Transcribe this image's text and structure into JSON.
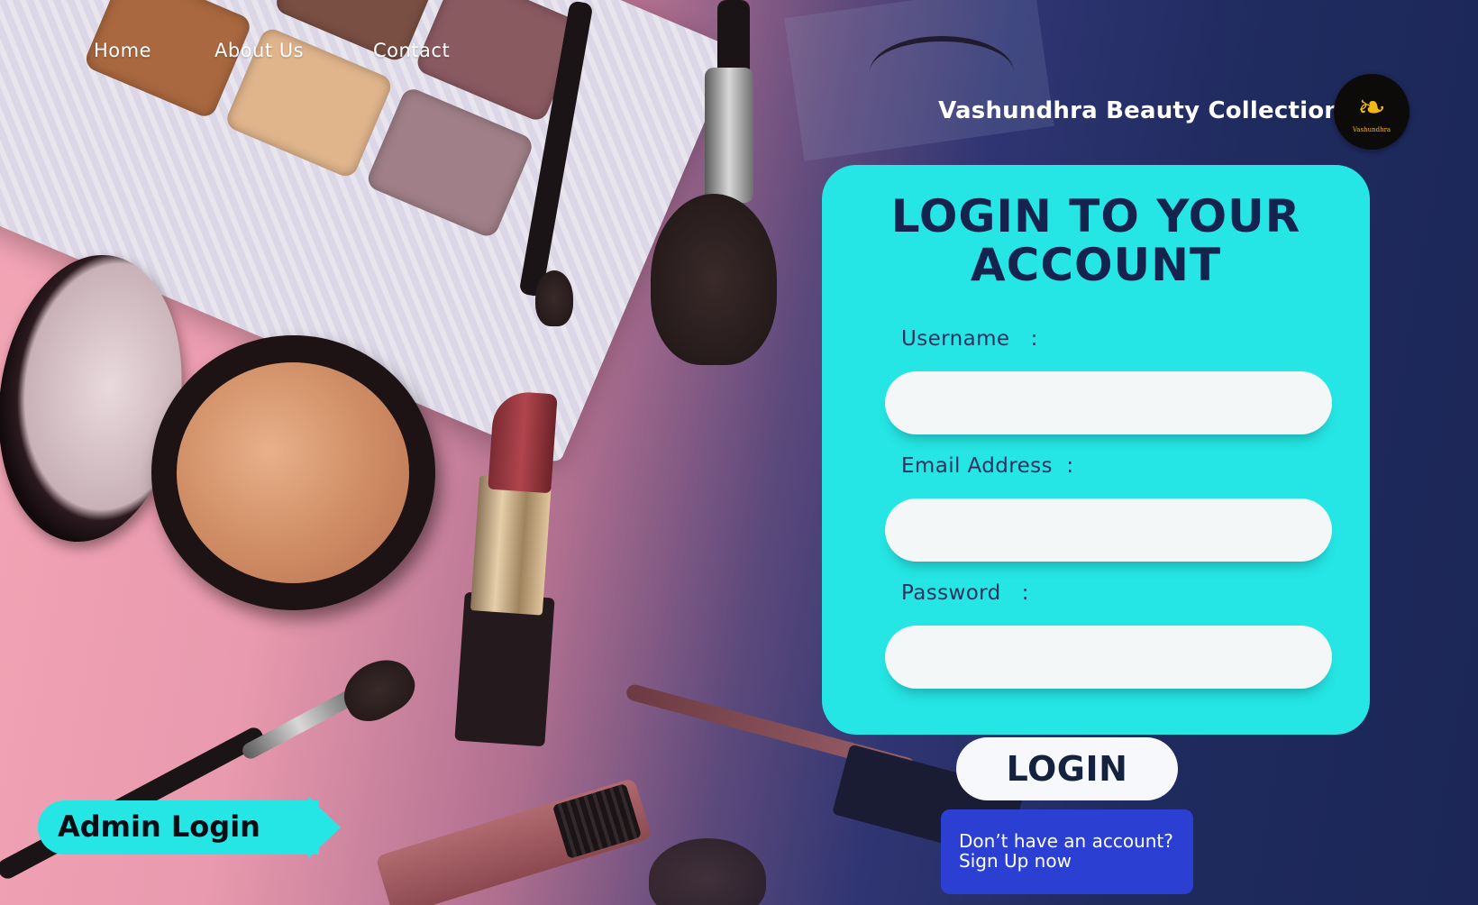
{
  "nav": {
    "items": [
      {
        "label": "Home"
      },
      {
        "label": "About Us"
      },
      {
        "label": "Contact"
      }
    ]
  },
  "brand": {
    "name": "Vashundhra Beauty Collection",
    "logo_text": "Vashundhra"
  },
  "login_card": {
    "title": "LOGIN TO YOUR\nACCOUNT",
    "fields": [
      {
        "label": "Username   :",
        "value": "",
        "placeholder": ""
      },
      {
        "label": "Email Address  :",
        "value": "",
        "placeholder": ""
      },
      {
        "label": "Password   :",
        "value": "",
        "placeholder": ""
      }
    ]
  },
  "login_button": {
    "label": "LOGIN"
  },
  "signup": {
    "line1": "Don’t have an account?",
    "line2": "Sign Up now"
  },
  "admin_login": {
    "label": "Admin Login"
  },
  "colors": {
    "card": "#25e6e4",
    "title_text": "#15234f",
    "signup_bg": "#2b3fd3",
    "bg_left": "#f3a6b6",
    "bg_right": "#1c2757"
  },
  "icons": {
    "logo": "woman-silhouette-icon"
  }
}
